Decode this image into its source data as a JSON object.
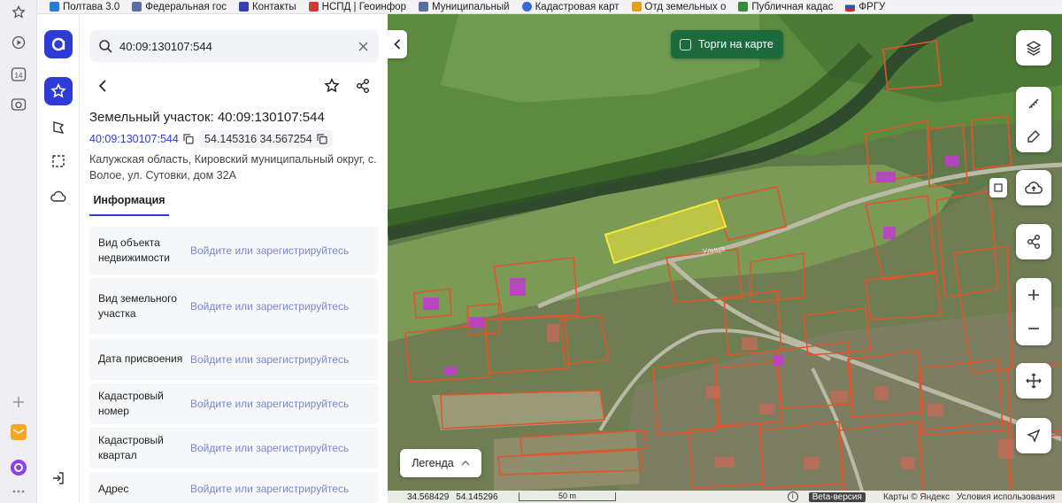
{
  "bookmarks": [
    {
      "label": "Полтава 3.0",
      "color": "#2b7bd6"
    },
    {
      "label": "Федеральная гос",
      "color": "#5a6fa8"
    },
    {
      "label": "Контакты",
      "color": "#3a3fb0"
    },
    {
      "label": "НСПД | Геоинфор",
      "color": "#d23a3a"
    },
    {
      "label": "Муниципальный",
      "color": "#5a6fa8"
    },
    {
      "label": "Кадастровая карт",
      "color": "#3a68d8"
    },
    {
      "label": "Отд земельных о",
      "color": "#e0a020"
    },
    {
      "label": "Публичная кадас",
      "color": "#3a8a3a"
    },
    {
      "label": "ФРГУ",
      "color": "#c83030"
    }
  ],
  "rail": {
    "badge": "14"
  },
  "search": {
    "value": "40:09:130107:544"
  },
  "object": {
    "title": "Земельный участок: 40:09:130107:544",
    "cadastral_number": "40:09:130107:544",
    "coordinates": "54.145316 34.567254",
    "address": "Калужская область, Кировский муниципальный округ, с. Волое, ул. Сутовки, дом 32А"
  },
  "tabs": {
    "info": "Информация"
  },
  "rows": [
    {
      "label": "Вид объекта недвижимости",
      "value": "Войдите или зарегистрируйтесь"
    },
    {
      "label": "Вид земельного участка",
      "value": "Войдите или зарегистрируйтесь"
    },
    {
      "label": "Дата присвоения",
      "value": "Войдите или зарегистрируйтесь"
    },
    {
      "label": "Кадастровый номер",
      "value": "Войдите или зарегистрируйтесь"
    },
    {
      "label": "Кадастровый квартал",
      "value": "Войдите или зарегистрируйтесь"
    },
    {
      "label": "Адрес",
      "value": "Войдите или зарегистрируйтесь"
    }
  ],
  "map": {
    "torgi_label": "Торги на карте",
    "legend_label": "Легенда",
    "coords_lon": "34.568429",
    "coords_lat": "54.145296",
    "scale_label": "50 m",
    "beta": "Beta-версия",
    "attribution": "Карты © Яндекс",
    "terms": "Условия использования",
    "street_label": "Улица"
  },
  "colors": {
    "accent": "#2f3bd6",
    "parcel": "#e0552c",
    "selected": "#f2ea3a",
    "building": "#c23bd1"
  }
}
